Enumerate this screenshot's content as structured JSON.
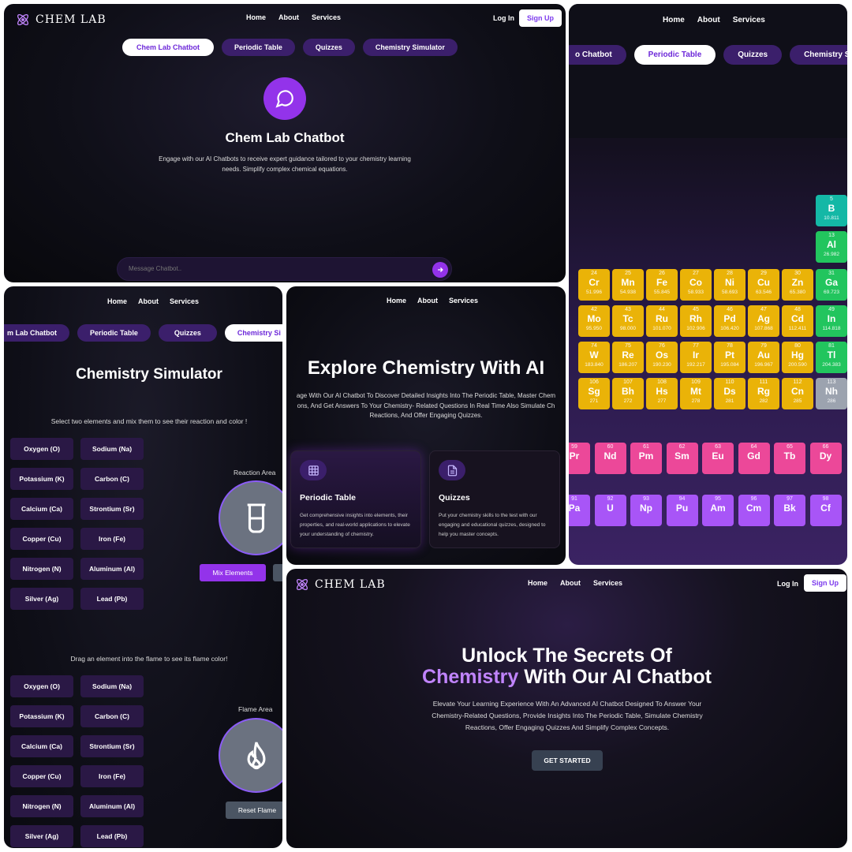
{
  "brand": {
    "name": "CHEM LAB"
  },
  "nav": {
    "home": "Home",
    "about": "About",
    "services": "Services",
    "login": "Log In",
    "signup": "Sign Up"
  },
  "tabs": [
    "Chem Lab Chatbot",
    "Periodic Table",
    "Quizzes",
    "Chemistry Simulator"
  ],
  "tabs_cropped": {
    "chatbot_left": "o Chatbot",
    "chatbot_left2": "m Lab Chatbot",
    "simulator_right": "Chemistry S",
    "simulator_right2": "Chemistry Si"
  },
  "chatbot": {
    "title": "Chem Lab Chatbot",
    "description": "Engage with our AI Chatbots to receive expert guidance tailored to your chemistry learning needs. Simplify complex chemical equations.",
    "input_placeholder": "Message Chatbot.."
  },
  "periodic_table": {
    "elements": [
      {
        "n": "5",
        "s": "B",
        "m": "10.811",
        "c": "teal"
      },
      {
        "n": "13",
        "s": "Al",
        "m": "26.982",
        "c": "green"
      },
      {
        "n": "24",
        "s": "Cr",
        "m": "51.996",
        "c": "yellow"
      },
      {
        "n": "25",
        "s": "Mn",
        "m": "54.938",
        "c": "yellow"
      },
      {
        "n": "26",
        "s": "Fe",
        "m": "55.845",
        "c": "yellow"
      },
      {
        "n": "27",
        "s": "Co",
        "m": "58.933",
        "c": "yellow"
      },
      {
        "n": "28",
        "s": "Ni",
        "m": "58.693",
        "c": "yellow"
      },
      {
        "n": "29",
        "s": "Cu",
        "m": "63.546",
        "c": "yellow"
      },
      {
        "n": "30",
        "s": "Zn",
        "m": "65.380",
        "c": "yellow"
      },
      {
        "n": "31",
        "s": "Ga",
        "m": "69.723",
        "c": "green"
      },
      {
        "n": "42",
        "s": "Mo",
        "m": "95.950",
        "c": "yellow"
      },
      {
        "n": "43",
        "s": "Tc",
        "m": "98.000",
        "c": "yellow"
      },
      {
        "n": "44",
        "s": "Ru",
        "m": "101.070",
        "c": "yellow"
      },
      {
        "n": "45",
        "s": "Rh",
        "m": "102.906",
        "c": "yellow"
      },
      {
        "n": "46",
        "s": "Pd",
        "m": "106.420",
        "c": "yellow"
      },
      {
        "n": "47",
        "s": "Ag",
        "m": "107.868",
        "c": "yellow"
      },
      {
        "n": "48",
        "s": "Cd",
        "m": "112.411",
        "c": "yellow"
      },
      {
        "n": "49",
        "s": "In",
        "m": "114.818",
        "c": "green"
      },
      {
        "n": "74",
        "s": "W",
        "m": "183.840",
        "c": "yellow"
      },
      {
        "n": "75",
        "s": "Re",
        "m": "186.207",
        "c": "yellow"
      },
      {
        "n": "76",
        "s": "Os",
        "m": "190.230",
        "c": "yellow"
      },
      {
        "n": "77",
        "s": "Ir",
        "m": "192.217",
        "c": "yellow"
      },
      {
        "n": "78",
        "s": "Pt",
        "m": "195.084",
        "c": "yellow"
      },
      {
        "n": "79",
        "s": "Au",
        "m": "196.967",
        "c": "yellow"
      },
      {
        "n": "80",
        "s": "Hg",
        "m": "200.590",
        "c": "yellow"
      },
      {
        "n": "81",
        "s": "Tl",
        "m": "204.383",
        "c": "green"
      },
      {
        "n": "106",
        "s": "Sg",
        "m": "271",
        "c": "yellow"
      },
      {
        "n": "107",
        "s": "Bh",
        "m": "272",
        "c": "yellow"
      },
      {
        "n": "108",
        "s": "Hs",
        "m": "277",
        "c": "yellow"
      },
      {
        "n": "109",
        "s": "Mt",
        "m": "278",
        "c": "yellow"
      },
      {
        "n": "110",
        "s": "Ds",
        "m": "281",
        "c": "yellow"
      },
      {
        "n": "111",
        "s": "Rg",
        "m": "282",
        "c": "yellow"
      },
      {
        "n": "112",
        "s": "Cn",
        "m": "285",
        "c": "yellow"
      },
      {
        "n": "113",
        "s": "Nh",
        "m": "286",
        "c": "gray"
      },
      {
        "n": "59",
        "s": "Pr",
        "m": "",
        "c": "pink"
      },
      {
        "n": "60",
        "s": "Nd",
        "m": "",
        "c": "pink"
      },
      {
        "n": "61",
        "s": "Pm",
        "m": "",
        "c": "pink"
      },
      {
        "n": "62",
        "s": "Sm",
        "m": "",
        "c": "pink"
      },
      {
        "n": "63",
        "s": "Eu",
        "m": "",
        "c": "pink"
      },
      {
        "n": "64",
        "s": "Gd",
        "m": "",
        "c": "pink"
      },
      {
        "n": "65",
        "s": "Tb",
        "m": "",
        "c": "pink"
      },
      {
        "n": "66",
        "s": "Dy",
        "m": "",
        "c": "pink"
      },
      {
        "n": "91",
        "s": "Pa",
        "m": "",
        "c": "violet"
      },
      {
        "n": "92",
        "s": "U",
        "m": "",
        "c": "violet"
      },
      {
        "n": "93",
        "s": "Np",
        "m": "",
        "c": "violet"
      },
      {
        "n": "94",
        "s": "Pu",
        "m": "",
        "c": "violet"
      },
      {
        "n": "95",
        "s": "Am",
        "m": "",
        "c": "violet"
      },
      {
        "n": "96",
        "s": "Cm",
        "m": "",
        "c": "violet"
      },
      {
        "n": "97",
        "s": "Bk",
        "m": "",
        "c": "violet"
      },
      {
        "n": "98",
        "s": "Cf",
        "m": "",
        "c": "violet"
      }
    ]
  },
  "simulator": {
    "title": "Chemistry Simulator",
    "mix_instructions": "Select two elements and mix them to see their reaction and color !",
    "flame_instructions": "Drag an element into the flame to see its flame color!",
    "reaction_area": "Reaction Area",
    "flame_area": "Flame Area",
    "mix_button": "Mix Elements",
    "reset_flame": "Reset Flame",
    "elements": [
      "Oxygen (O)",
      "Sodium (Na)",
      "Potassium (K)",
      "Carbon (C)",
      "Calcium (Ca)",
      "Strontium (Sr)",
      "Copper (Cu)",
      "Iron (Fe)",
      "Nitrogen (N)",
      "Aluminum (Al)",
      "Silver (Ag)",
      "Lead (Pb)"
    ]
  },
  "explore": {
    "title": "Explore Chemistry With AI",
    "description_line1": "age With Our AI Chatbot To Discover Detailed Insights Into The Periodic Table, Master Chem",
    "description_line2": "ons, And Get Answers To Your Chemistry- Related Questions In Real Time Also Simulate Ch",
    "description_line3": "Reactions, And Offer Engaging Quizzes.",
    "cards": [
      {
        "title": "Periodic Table",
        "desc": "Get comprehensive insights into elements, their properties, and real-world applications to elevate your understanding of chemistry.",
        "icon": "table-icon"
      },
      {
        "title": "Quizzes",
        "desc": "Put your chemistry skills to the test with our engaging and educational quizzes, designed to help you master concepts.",
        "icon": "document-icon"
      }
    ]
  },
  "hero": {
    "line1": "Unlock The Secrets Of",
    "accent": "Chemistry",
    "line2_rest": " With Our AI Chatbot",
    "description": "Elevate Your Learning Experience With An Advanced AI Chatbot Designed To Answer Your Chemistry-Related Questions, Provide Insights Into The Periodic Table, Simulate Chemistry Reactions, Offer Engaging Quizzes And Simplify Complex Concepts.",
    "cta": "GET STARTED"
  },
  "colors": {
    "accent": "#9333ea",
    "pill_bg": "#3b1f6b",
    "element_button": "#2a1845"
  }
}
